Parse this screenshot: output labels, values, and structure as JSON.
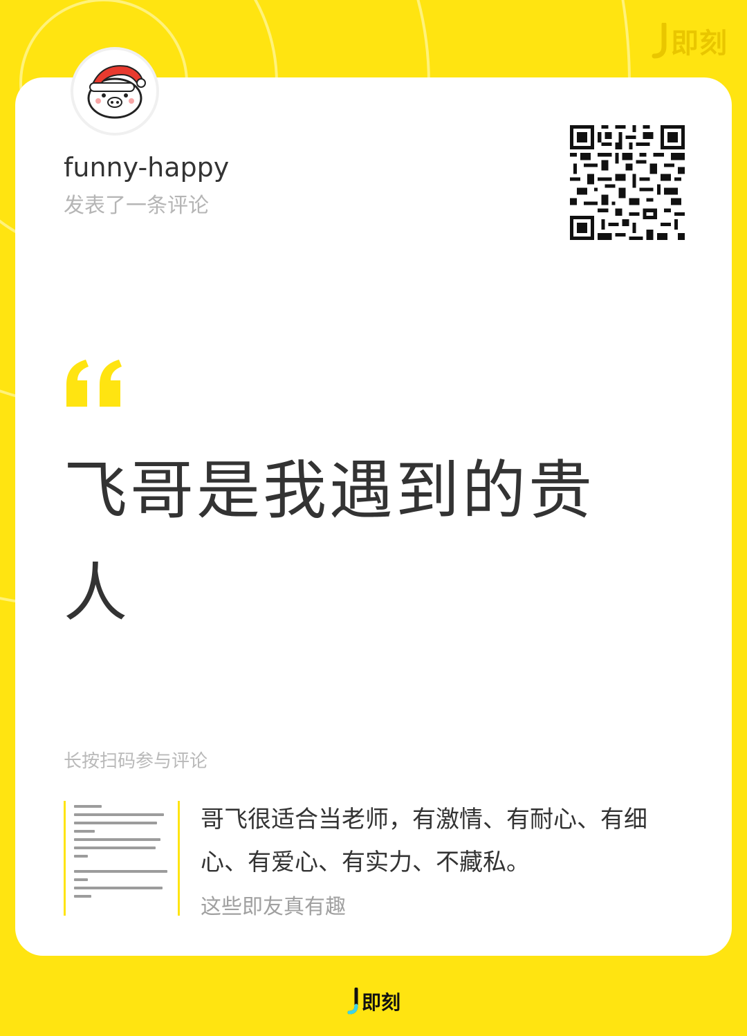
{
  "brand": {
    "name": "即刻",
    "accent_color": "#FFE411",
    "logo_icon": "jike-j-icon"
  },
  "post": {
    "username": "funny-happy",
    "action": "发表了一条评论",
    "avatar_icon": "pig-santa-hat-avatar-icon",
    "quote_icon": "quote-mark-icon",
    "headline": "飞哥是我遇到的贵人",
    "qr_icon": "qr-code-icon"
  },
  "footer": {
    "hint": "长按扫码参与评论",
    "excerpt": "哥飞很适合当老师，有激情、有耐心、有细心、有爱心、有实力、不藏私。",
    "topic": "这些即友真有趣",
    "thumbnail_icon": "post-screenshot-thumbnail"
  }
}
